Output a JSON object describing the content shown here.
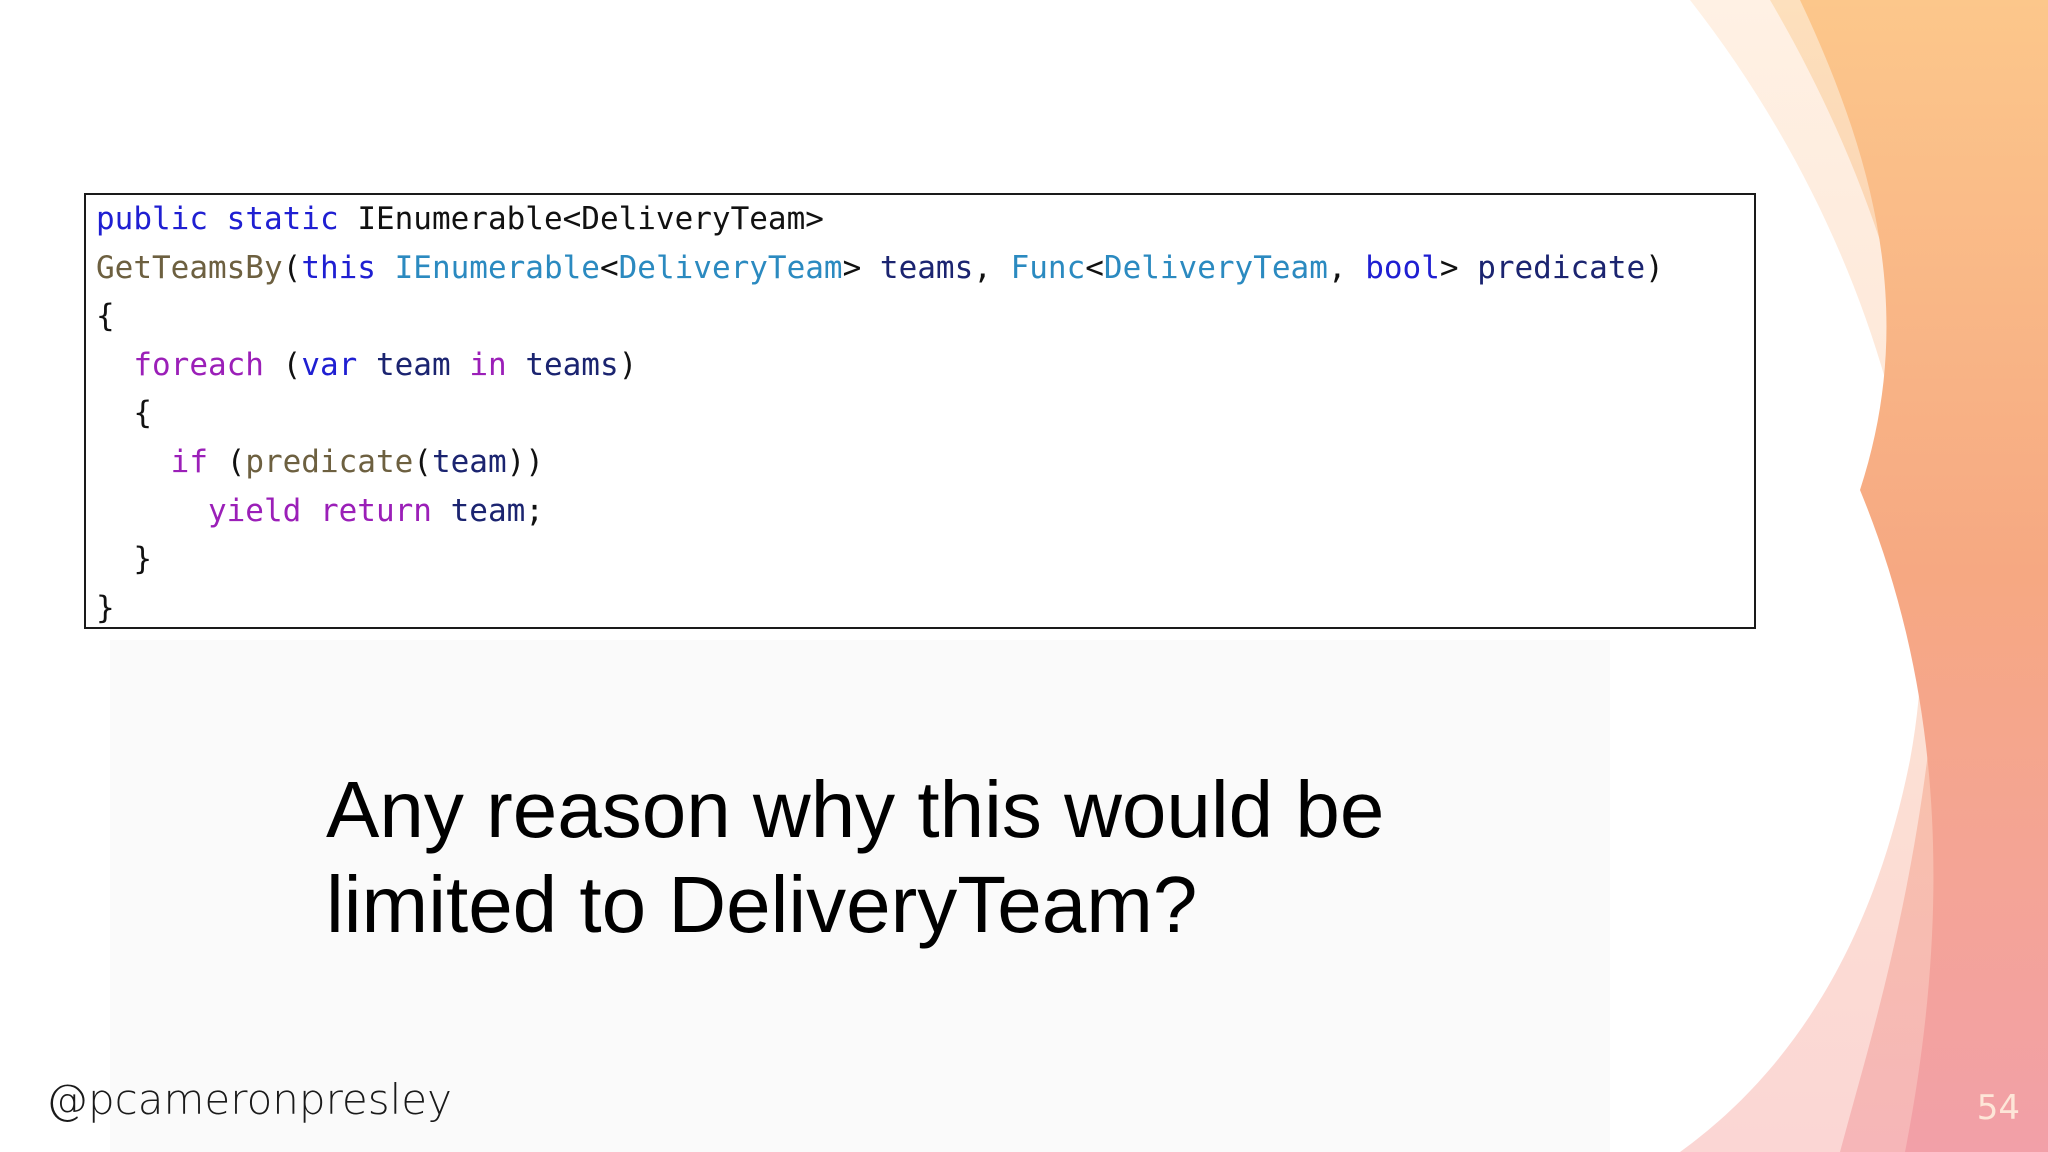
{
  "slide": {
    "accent_colors": [
      "#fbc98a",
      "#f4a07c",
      "#f2a3a6"
    ],
    "code": {
      "lines": [
        {
          "tokens": [
            {
              "t": "public",
              "k": "kw"
            },
            {
              "t": " ",
              "k": "plain"
            },
            {
              "t": "static",
              "k": "kw"
            },
            {
              "t": " ",
              "k": "plain"
            },
            {
              "t": "IEnumerable<DeliveryTeam>",
              "k": "plain"
            }
          ]
        },
        {
          "tokens": [
            {
              "t": "GetTeamsBy",
              "k": "method"
            },
            {
              "t": "(",
              "k": "plain"
            },
            {
              "t": "this",
              "k": "kw"
            },
            {
              "t": " ",
              "k": "plain"
            },
            {
              "t": "IEnumerable",
              "k": "type"
            },
            {
              "t": "<",
              "k": "plain"
            },
            {
              "t": "DeliveryTeam",
              "k": "type"
            },
            {
              "t": "> ",
              "k": "plain"
            },
            {
              "t": "teams",
              "k": "id"
            },
            {
              "t": ", ",
              "k": "plain"
            },
            {
              "t": "Func",
              "k": "type"
            },
            {
              "t": "<",
              "k": "plain"
            },
            {
              "t": "DeliveryTeam",
              "k": "type"
            },
            {
              "t": ", ",
              "k": "plain"
            },
            {
              "t": "bool",
              "k": "kw"
            },
            {
              "t": "> ",
              "k": "plain"
            },
            {
              "t": "predicate",
              "k": "id"
            },
            {
              "t": ")",
              "k": "plain"
            }
          ]
        },
        {
          "tokens": [
            {
              "t": "{",
              "k": "plain"
            }
          ]
        },
        {
          "tokens": [
            {
              "t": "  ",
              "k": "plain"
            },
            {
              "t": "foreach",
              "k": "ctl"
            },
            {
              "t": " (",
              "k": "plain"
            },
            {
              "t": "var",
              "k": "kw"
            },
            {
              "t": " ",
              "k": "plain"
            },
            {
              "t": "team",
              "k": "id"
            },
            {
              "t": " ",
              "k": "plain"
            },
            {
              "t": "in",
              "k": "ctl"
            },
            {
              "t": " ",
              "k": "plain"
            },
            {
              "t": "teams",
              "k": "id"
            },
            {
              "t": ")",
              "k": "plain"
            }
          ]
        },
        {
          "tokens": [
            {
              "t": "  {",
              "k": "plain"
            }
          ]
        },
        {
          "tokens": [
            {
              "t": "    ",
              "k": "plain"
            },
            {
              "t": "if",
              "k": "ctl"
            },
            {
              "t": " (",
              "k": "plain"
            },
            {
              "t": "predicate",
              "k": "method"
            },
            {
              "t": "(",
              "k": "plain"
            },
            {
              "t": "team",
              "k": "id"
            },
            {
              "t": "))",
              "k": "plain"
            }
          ]
        },
        {
          "tokens": [
            {
              "t": "      ",
              "k": "plain"
            },
            {
              "t": "yield",
              "k": "ctl"
            },
            {
              "t": " ",
              "k": "plain"
            },
            {
              "t": "return",
              "k": "ctl"
            },
            {
              "t": " ",
              "k": "plain"
            },
            {
              "t": "team",
              "k": "id"
            },
            {
              "t": ";",
              "k": "plain"
            }
          ]
        },
        {
          "tokens": [
            {
              "t": "  }",
              "k": "plain"
            }
          ]
        },
        {
          "tokens": [
            {
              "t": "}",
              "k": "plain"
            }
          ]
        }
      ]
    },
    "question": {
      "line1": "Any reason why this would be",
      "line2": "limited to DeliveryTeam?"
    },
    "footer": {
      "handle": "@pcameronpresley",
      "page_number": "54"
    }
  }
}
